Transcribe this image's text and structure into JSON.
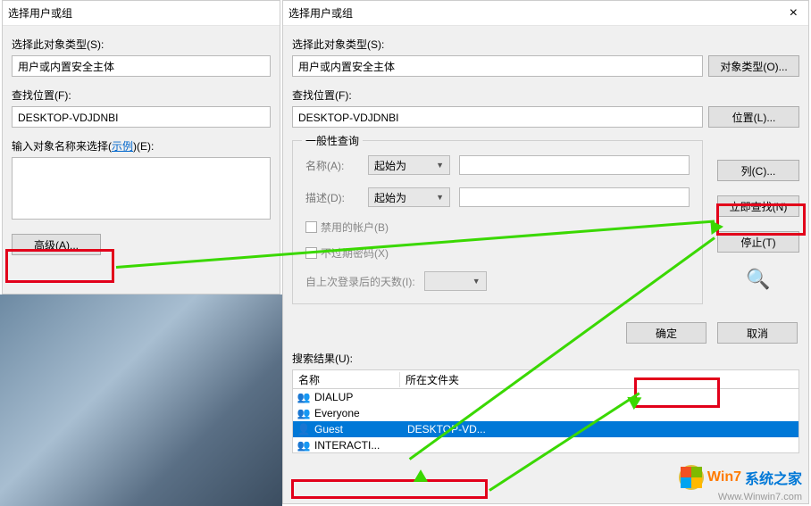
{
  "back": {
    "title": "选择用户或组",
    "objTypeLabel": "选择此对象类型(S):",
    "objTypeValue": "用户或内置安全主体",
    "locationLabel": "查找位置(F):",
    "locationValue": "DESKTOP-VDJDNBI",
    "enterNamesLabel": "输入对象名称来选择(",
    "exampleLink": "示例",
    "enterNamesAfter": ")(E):",
    "advancedBtn": "高级(A)..."
  },
  "front": {
    "title": "选择用户或组",
    "objTypeLabel": "选择此对象类型(S):",
    "objTypeValue": "用户或内置安全主体",
    "objTypeBtn": "对象类型(O)...",
    "locationLabel": "查找位置(F):",
    "locationValue": "DESKTOP-VDJDNBI",
    "locationBtn": "位置(L)...",
    "groupTitle": "一般性查询",
    "nameLabel": "名称(A):",
    "descLabel": "描述(D):",
    "startsWith": "起始为",
    "disabledChk": "禁用的帐户(B)",
    "noExpireChk": "不过期密码(X)",
    "daysSinceLabel": "自上次登录后的天数(I):",
    "columnsBtn": "列(C)...",
    "findNowBtn": "立即查找(N)",
    "stopBtn": "停止(T)",
    "okBtn": "确定",
    "cancelBtn": "取消",
    "resultsLabel": "搜索结果(U):",
    "colName": "名称",
    "colFolder": "所在文件夹",
    "rows": [
      {
        "name": "DIALUP",
        "folder": ""
      },
      {
        "name": "Everyone",
        "folder": ""
      },
      {
        "name": "Guest",
        "folder": "DESKTOP-VD..."
      },
      {
        "name": "INTERACTI...",
        "folder": ""
      }
    ],
    "selectedRowIndex": 2
  },
  "watermark": {
    "brand1": "Win7",
    "brand2": "系统之家",
    "url": "Www.Winwin7.com"
  }
}
